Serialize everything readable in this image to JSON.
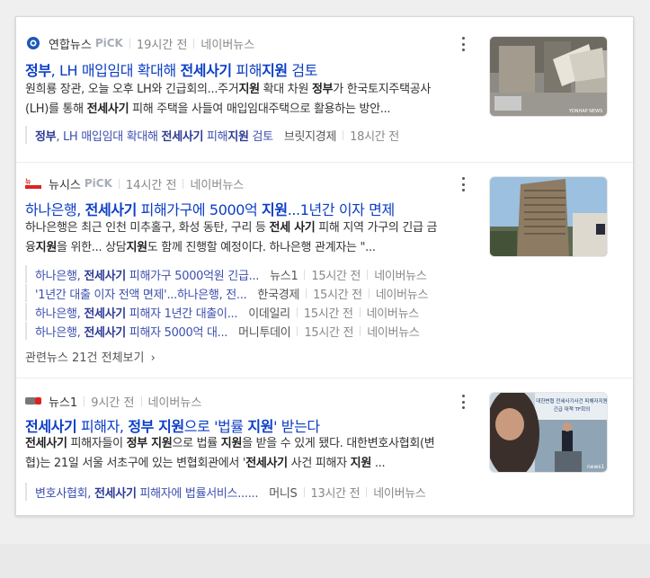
{
  "items": [
    {
      "press": "연합뉴스",
      "pick": "PiCK",
      "time": "19시간 전",
      "source": "네이버뉴스",
      "title_parts": [
        [
          "정부",
          1
        ],
        [
          ", LH 매입임대 확대해 ",
          0
        ],
        [
          "전세사기",
          1
        ],
        [
          " 피해",
          0
        ],
        [
          "지원",
          1
        ],
        [
          " 검토",
          0
        ]
      ],
      "desc": "원희룡 장관, 오늘 오후 LH와 긴급회의...주거지원 확대 차원 정부가 한국토지주택공사(LH)를 통해 전세사기 피해 주택을 사들여 매입임대주택으로 활용하는 방안...",
      "related": [
        {
          "title": "정부, LH 매입임대 확대해 전세사기 피해지원 검토",
          "press": "브릿지경제",
          "time": "18시간 전",
          "source": ""
        }
      ]
    },
    {
      "press": "뉴시스",
      "pick": "PiCK",
      "time": "14시간 전",
      "source": "네이버뉴스",
      "title_parts": [
        [
          "하나은행, ",
          0
        ],
        [
          "전세사기",
          1
        ],
        [
          " 피해가구에 5000억 ",
          0
        ],
        [
          "지원",
          1
        ],
        [
          "...1년간 이자 면제",
          0
        ]
      ],
      "desc": "하나은행은 최근 인천 미추홀구, 화성 동탄, 구리 등 전세 사기 피해 지역 가구의 긴급 금융지원을 위한... 상담지원도 함께 진행할 예정이다. 하나은행 관계자는 \"...",
      "related": [
        {
          "title": "하나은행, 전세사기 피해가구 5000억원 긴급...",
          "press": "뉴스1",
          "time": "15시간 전",
          "source": "네이버뉴스"
        },
        {
          "title": "'1년간 대출 이자 전액 면제'...하나은행, 전...",
          "press": "한국경제",
          "time": "15시간 전",
          "source": "네이버뉴스"
        },
        {
          "title": "하나은행, 전세사기 피해자 1년간 대출이...",
          "press": "이데일리",
          "time": "15시간 전",
          "source": "네이버뉴스"
        },
        {
          "title": "하나은행, 전세사기 피해자 5000억 대...",
          "press": "머니투데이",
          "time": "15시간 전",
          "source": "네이버뉴스"
        }
      ],
      "more": "관련뉴스 21건 전체보기"
    },
    {
      "press": "뉴스1",
      "pick": "",
      "time": "9시간 전",
      "source": "네이버뉴스",
      "title_parts": [
        [
          "전세사기",
          1
        ],
        [
          " 피해자, ",
          0
        ],
        [
          "정부 지원",
          1
        ],
        [
          "으로 '법률 ",
          0
        ],
        [
          "지원",
          1
        ],
        [
          "' 받는다",
          0
        ]
      ],
      "desc": "전세사기 피해자들이 정부 지원으로 법률 지원을 받을 수 있게 됐다. 대한변호사협회(변협)는 21일 서울 서초구에 있는 변협회관에서 '전세사기 사건 피해자 지원 ...",
      "related": [
        {
          "title": "변호사협회, 전세사기 피해자에 법률서비스......",
          "press": "머니S",
          "time": "13시간 전",
          "source": "네이버뉴스"
        }
      ]
    }
  ],
  "thumb_captions": [
    "YONHAP NEWS",
    "",
    "news1"
  ],
  "thumb3_banner": [
    "대한변협 전세사기사건 피해자지원",
    "긴급 대책 TF회의"
  ],
  "colors": {
    "link": "#0c3ec6",
    "accent": "#d22"
  }
}
